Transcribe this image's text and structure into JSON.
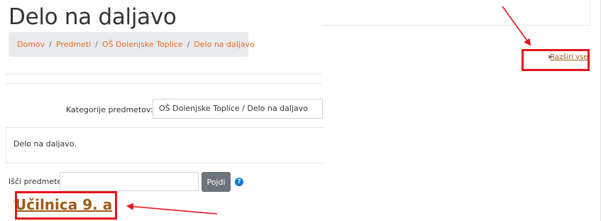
{
  "page": {
    "title": "Delo na daljavo"
  },
  "breadcrumb": {
    "items": [
      "Domov",
      "Predmeti",
      "OŠ Dolenjske Toplice",
      "Delo na daljavo"
    ],
    "separator": "/"
  },
  "category": {
    "label": "Kategorije predmetov:",
    "selected": "OŠ Dolenjske Toplice / Delo na daljavo"
  },
  "description": {
    "text": "Delo na daljavo."
  },
  "search": {
    "label": "Išči predmete",
    "value": "",
    "button_label": "Pojdi",
    "help_icon": "question-circle-icon"
  },
  "course": {
    "name": "Učilnica 9. a",
    "icon": "course-icon"
  },
  "expand": {
    "label": "Razširi vse",
    "caret_icon": "caret-right-icon"
  },
  "colors": {
    "link": "#9e5b17",
    "breadcrumb_link": "#e96a25",
    "highlight": "#e8141c",
    "button": "#6c757d",
    "help": "#1177d1"
  }
}
